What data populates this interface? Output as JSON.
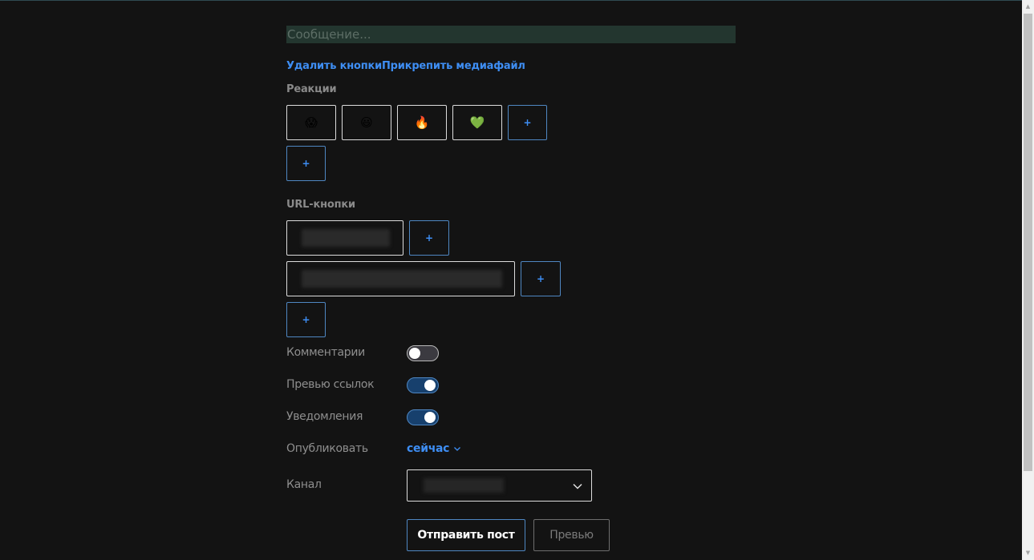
{
  "message": {
    "placeholder": "Сообщение...",
    "value": ""
  },
  "actions": {
    "remove_buttons": "Удалить кнопки",
    "attach_media": "Прикрепить медиафайл"
  },
  "reactions": {
    "label": "Реакции",
    "items": [
      {
        "emoji": "😱",
        "icon": "scream-emoji-icon"
      },
      {
        "emoji": "😃",
        "icon": "smile-emoji-icon"
      },
      {
        "emoji": "🔥",
        "icon": "fire-emoji-icon"
      },
      {
        "emoji": "💚",
        "icon": "green-heart-emoji-icon"
      }
    ],
    "add_inline": "+",
    "add_row": "+"
  },
  "url_buttons": {
    "label": "URL-кнопки",
    "add_row1": "+",
    "add_row2": "+",
    "add_new_row": "+"
  },
  "settings": {
    "comments": {
      "label": "Комментарии",
      "enabled": false
    },
    "link_preview": {
      "label": "Превью ссылок",
      "enabled": true
    },
    "notifications": {
      "label": "Уведомления",
      "enabled": true
    },
    "publish": {
      "label": "Опубликовать",
      "value": "сейчас"
    },
    "channel": {
      "label": "Канал",
      "value": ""
    }
  },
  "footer": {
    "send": "Отправить пост",
    "preview": "Превью"
  },
  "colors": {
    "background": "#131313",
    "accent": "#3e8ef4",
    "toggle_on": "#17406d",
    "message_bg": "#23362f"
  }
}
